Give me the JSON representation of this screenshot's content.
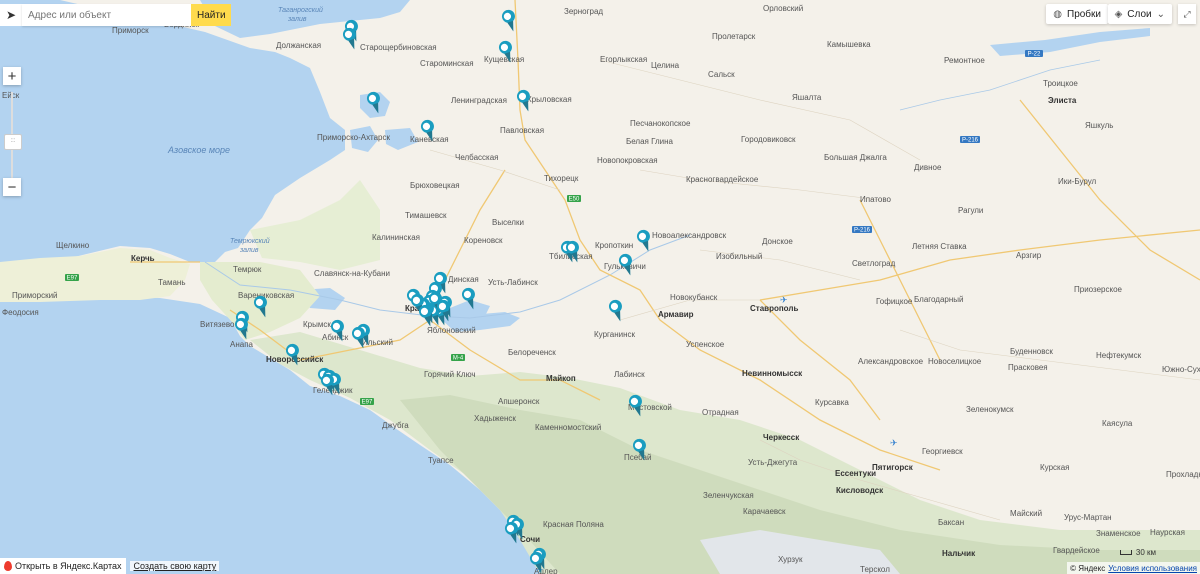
{
  "search": {
    "placeholder": "Адрес или объект",
    "find_label": "Найти"
  },
  "controls": {
    "zoom_in": "+",
    "zoom_out": "−",
    "traffic_label": "Пробки",
    "layers_label": "Слои",
    "slider_grip": ":::"
  },
  "bottom": {
    "open_in_yandex": "Открыть в Яндекс.Картах",
    "create_map": "Создать свою карту",
    "scale": "30 км",
    "copyright": "© Яндекс",
    "terms": "Условия использования"
  },
  "seas": [
    {
      "name": "Азовское море"
    },
    {
      "name": "Таганрогский залив"
    },
    {
      "name": "Темрюкский залив"
    }
  ],
  "roads": [
    "E97",
    "E50",
    "M-4",
    "P-22",
    "P-216",
    "P-216",
    "E97"
  ],
  "cities": [
    {
      "name": "Бердянск",
      "bold": false
    },
    {
      "name": "Приморск",
      "bold": false
    },
    {
      "name": "Должанская",
      "bold": false
    },
    {
      "name": "Ейск",
      "bold": false
    },
    {
      "name": "Староминская",
      "bold": false
    },
    {
      "name": "Старощербиновская",
      "bold": false
    },
    {
      "name": "Зерноград",
      "bold": false
    },
    {
      "name": "Орловский",
      "bold": false
    },
    {
      "name": "Пролетарск",
      "bold": false
    },
    {
      "name": "Камышевка",
      "bold": false
    },
    {
      "name": "Ремонтное",
      "bold": false
    },
    {
      "name": "Кущевская",
      "bold": false
    },
    {
      "name": "Егорлыкская",
      "bold": false
    },
    {
      "name": "Целина",
      "bold": false
    },
    {
      "name": "Сальск",
      "bold": false
    },
    {
      "name": "Яшалта",
      "bold": false
    },
    {
      "name": "Троицкое",
      "bold": false
    },
    {
      "name": "Элиста",
      "bold": true
    },
    {
      "name": "Ленинградская",
      "bold": false
    },
    {
      "name": "Крыловская",
      "bold": false
    },
    {
      "name": "Павловская",
      "bold": false
    },
    {
      "name": "Песчанокопское",
      "bold": false
    },
    {
      "name": "Яшкуль",
      "bold": false
    },
    {
      "name": "Приморско-Ахтарск",
      "bold": false
    },
    {
      "name": "Каневская",
      "bold": false
    },
    {
      "name": "Челбасская",
      "bold": false
    },
    {
      "name": "Белая Глина",
      "bold": false
    },
    {
      "name": "Городовиковск",
      "bold": false
    },
    {
      "name": "Новопокровская",
      "bold": false
    },
    {
      "name": "Большая Джалга",
      "bold": false
    },
    {
      "name": "Дивное",
      "bold": false
    },
    {
      "name": "Брюховецкая",
      "bold": false
    },
    {
      "name": "Тихорецк",
      "bold": false
    },
    {
      "name": "Красногвардейское",
      "bold": false
    },
    {
      "name": "Ипатово",
      "bold": false
    },
    {
      "name": "Ики-Бурул",
      "bold": false
    },
    {
      "name": "Тимашевск",
      "bold": false
    },
    {
      "name": "Выселки",
      "bold": false
    },
    {
      "name": "Рагули",
      "bold": false
    },
    {
      "name": "Щелкино",
      "bold": false
    },
    {
      "name": "Калининская",
      "bold": false
    },
    {
      "name": "Кореновск",
      "bold": false
    },
    {
      "name": "Кропоткин",
      "bold": false
    },
    {
      "name": "Новоалександровск",
      "bold": false
    },
    {
      "name": "Донское",
      "bold": false
    },
    {
      "name": "Летняя Ставка",
      "bold": false
    },
    {
      "name": "Керчь",
      "bold": true
    },
    {
      "name": "Темрюк",
      "bold": false
    },
    {
      "name": "Славянск-на-Кубани",
      "bold": false
    },
    {
      "name": "Тбилисская",
      "bold": false
    },
    {
      "name": "Гулькевичи",
      "bold": false
    },
    {
      "name": "Изобильный",
      "bold": false
    },
    {
      "name": "Светлоград",
      "bold": false
    },
    {
      "name": "Арзгир",
      "bold": false
    },
    {
      "name": "Тамань",
      "bold": false
    },
    {
      "name": "Динская",
      "bold": false
    },
    {
      "name": "Усть-Лабинск",
      "bold": false
    },
    {
      "name": "Новокубанск",
      "bold": false
    },
    {
      "name": "Ставрополь",
      "bold": true
    },
    {
      "name": "Гофицкое",
      "bold": false
    },
    {
      "name": "Благодарный",
      "bold": false
    },
    {
      "name": "Приозерское",
      "bold": false
    },
    {
      "name": "Приморский",
      "bold": false
    },
    {
      "name": "Феодосия",
      "bold": false
    },
    {
      "name": "Варениковская",
      "bold": false
    },
    {
      "name": "Краснодар",
      "bold": true
    },
    {
      "name": "Армавир",
      "bold": true
    },
    {
      "name": "Курганинск",
      "bold": false
    },
    {
      "name": "Витязево",
      "bold": false
    },
    {
      "name": "Крымск",
      "bold": false
    },
    {
      "name": "Анапа",
      "bold": false
    },
    {
      "name": "Абинск",
      "bold": false
    },
    {
      "name": "Ильский",
      "bold": false
    },
    {
      "name": "Яблоновский",
      "bold": false
    },
    {
      "name": "Успенское",
      "bold": false
    },
    {
      "name": "Буденновск",
      "bold": false
    },
    {
      "name": "Новороссийск",
      "bold": true
    },
    {
      "name": "Белореченск",
      "bold": false
    },
    {
      "name": "Александровское",
      "bold": false
    },
    {
      "name": "Новоселицкое",
      "bold": false
    },
    {
      "name": "Нефтекумск",
      "bold": false
    },
    {
      "name": "Горячий Ключ",
      "bold": false
    },
    {
      "name": "Майкоп",
      "bold": true
    },
    {
      "name": "Лабинск",
      "bold": false
    },
    {
      "name": "Невинномысск",
      "bold": true
    },
    {
      "name": "Прасковея",
      "bold": false
    },
    {
      "name": "Южно-Сухо",
      "bold": false
    },
    {
      "name": "Геленджик",
      "bold": false
    },
    {
      "name": "Апшеронск",
      "bold": false
    },
    {
      "name": "Курсавка",
      "bold": false
    },
    {
      "name": "Хадыженск",
      "bold": false
    },
    {
      "name": "Мостовской",
      "bold": false
    },
    {
      "name": "Отрадная",
      "bold": false
    },
    {
      "name": "Зеленокумск",
      "bold": false
    },
    {
      "name": "Джубга",
      "bold": false
    },
    {
      "name": "Каменномостский",
      "bold": false
    },
    {
      "name": "Черкесск",
      "bold": true
    },
    {
      "name": "Каясула",
      "bold": false
    },
    {
      "name": "Псебай",
      "bold": false
    },
    {
      "name": "Георгиевск",
      "bold": false
    },
    {
      "name": "Туапсе",
      "bold": false
    },
    {
      "name": "Усть-Джегута",
      "bold": false
    },
    {
      "name": "Ессентуки",
      "bold": true
    },
    {
      "name": "Пятигорск",
      "bold": true
    },
    {
      "name": "Курская",
      "bold": false
    },
    {
      "name": "Кисловодск",
      "bold": true
    },
    {
      "name": "Зеленчукская",
      "bold": false
    },
    {
      "name": "Прохладный",
      "bold": false
    },
    {
      "name": "Карачаевск",
      "bold": false
    },
    {
      "name": "Красная Поляна",
      "bold": false
    },
    {
      "name": "Баксан",
      "bold": false
    },
    {
      "name": "Наурская",
      "bold": false
    },
    {
      "name": "Сочи",
      "bold": true
    },
    {
      "name": "Знаменское",
      "bold": false
    },
    {
      "name": "Нальчик",
      "bold": true
    },
    {
      "name": "Майский",
      "bold": false
    },
    {
      "name": "Хурзук",
      "bold": false
    },
    {
      "name": "Терскол",
      "bold": false
    },
    {
      "name": "Адлер",
      "bold": false
    },
    {
      "name": "Гвардейское",
      "bold": false
    },
    {
      "name": "Урус-Мартан",
      "bold": false
    }
  ],
  "markers_count": 48,
  "colors": {
    "marker": "#1a9dc0",
    "sea": "#b3d3f0",
    "land": "#f4f1ea",
    "forest": "#dbe8c8",
    "mountain": "#d9e3cc",
    "road": "#f0c873",
    "find_button": "#ffdb4d"
  }
}
